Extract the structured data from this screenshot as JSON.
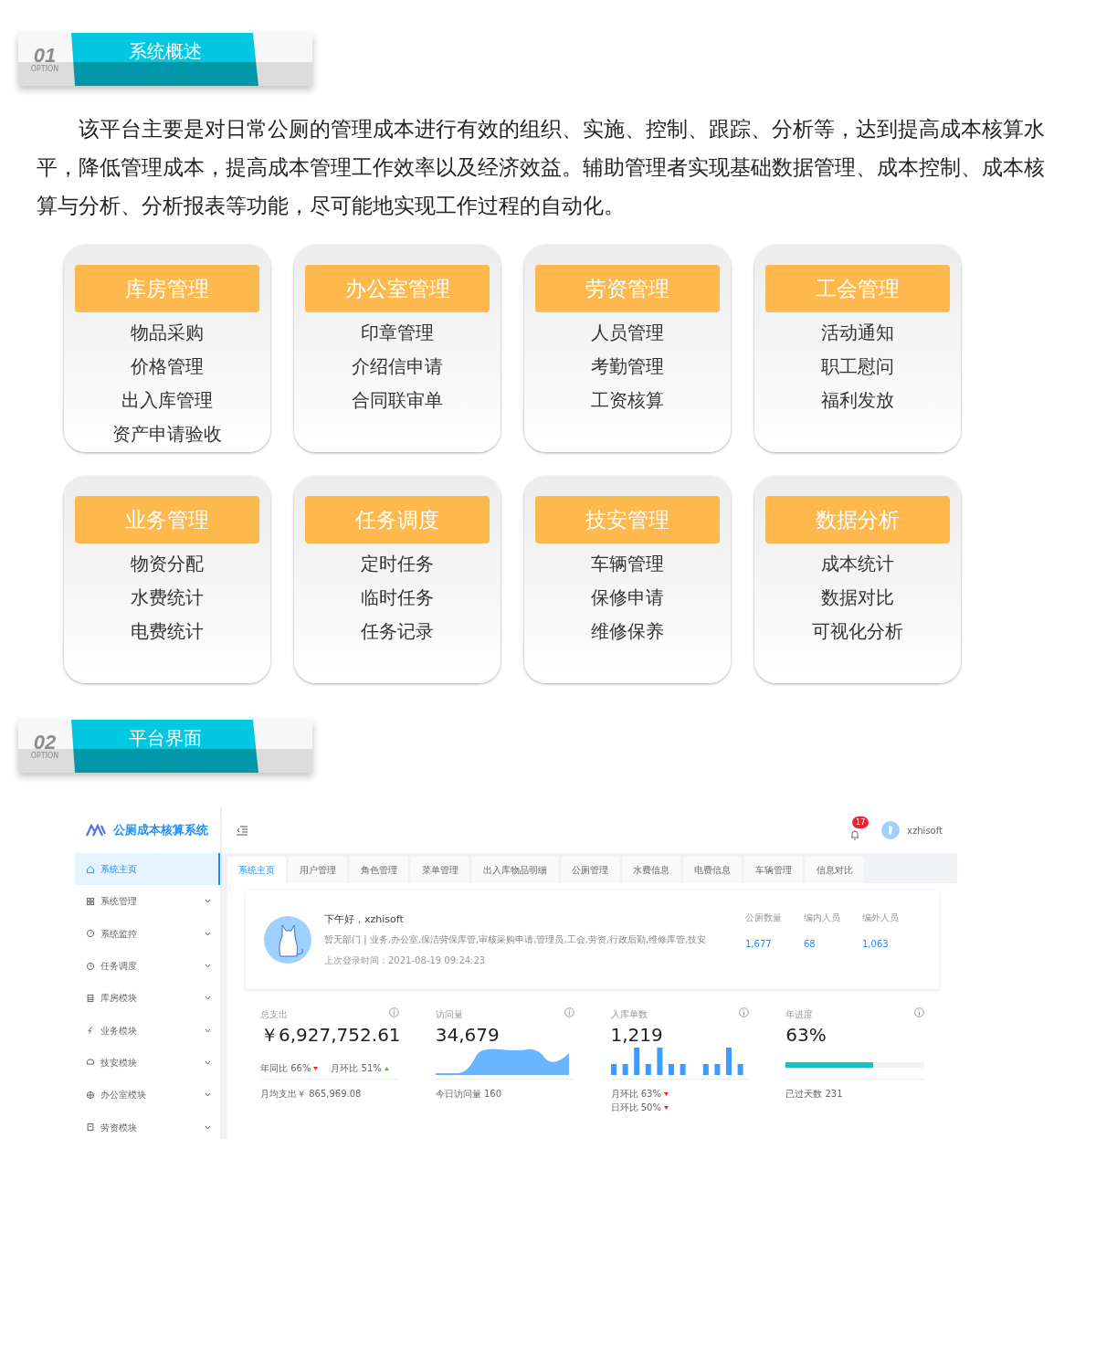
{
  "section_1": {
    "number": "01",
    "option": "OPTION",
    "title": "系统概述"
  },
  "intro": "该平台主要是对日常公厕的管理成本进行有效的组织、实施、控制、跟踪、分析等，达到提高成本核算水平，降低管理成本，提高成本管理工作效率以及经济效益。辅助管理者实现基础数据管理、成本控制、成本核算与分析、分析报表等功能，尽可能地实现工作过程的自动化。",
  "modules": [
    {
      "title": "库房管理",
      "items": [
        "物品采购",
        "价格管理",
        "出入库管理",
        "资产申请验收"
      ]
    },
    {
      "title": "办公室管理",
      "items": [
        "印章管理",
        "介绍信申请",
        "合同联审单"
      ]
    },
    {
      "title": "劳资管理",
      "items": [
        "人员管理",
        "考勤管理",
        "工资核算"
      ]
    },
    {
      "title": "工会管理",
      "items": [
        "活动通知",
        "职工慰问",
        "福利发放"
      ]
    },
    {
      "title": "业务管理",
      "items": [
        "物资分配",
        "水费统计",
        "电费统计"
      ]
    },
    {
      "title": "任务调度",
      "items": [
        "定时任务",
        "临时任务",
        "任务记录"
      ]
    },
    {
      "title": "技安管理",
      "items": [
        "车辆管理",
        "保修申请",
        "维修保养"
      ]
    },
    {
      "title": "数据分析",
      "items": [
        "成本统计",
        "数据对比",
        "可视化分析"
      ]
    }
  ],
  "section_2": {
    "number": "02",
    "option": "OPTION",
    "title": "平台界面"
  },
  "app": {
    "brand": "公厕成本核算系统",
    "sidebar": [
      {
        "label": "系统主页",
        "selected": true,
        "expandable": false
      },
      {
        "label": "系统管理",
        "selected": false,
        "expandable": true
      },
      {
        "label": "系统监控",
        "selected": false,
        "expandable": true
      },
      {
        "label": "任务调度",
        "selected": false,
        "expandable": true
      },
      {
        "label": "库房模块",
        "selected": false,
        "expandable": true
      },
      {
        "label": "业务模块",
        "selected": false,
        "expandable": true
      },
      {
        "label": "技安模块",
        "selected": false,
        "expandable": true
      },
      {
        "label": "办公室模块",
        "selected": false,
        "expandable": true
      },
      {
        "label": "劳资模块",
        "selected": false,
        "expandable": true
      }
    ],
    "notifications": "17",
    "user": "xzhisoft",
    "tabs": [
      {
        "label": "系统主页",
        "selected": true
      },
      {
        "label": "用户管理",
        "selected": false
      },
      {
        "label": "角色管理",
        "selected": false
      },
      {
        "label": "菜单管理",
        "selected": false
      },
      {
        "label": "出入库物品明细",
        "selected": false
      },
      {
        "label": "公厕管理",
        "selected": false
      },
      {
        "label": "水费信息",
        "selected": false
      },
      {
        "label": "电费信息",
        "selected": false
      },
      {
        "label": "车辆管理",
        "selected": false
      },
      {
        "label": "信息对比",
        "selected": false
      }
    ],
    "welcome": {
      "greeting": "下午好，xzhisoft",
      "roles": "暂无部门 | 业务,办公室,保洁劳保库管,审核采购申请,管理员,工会,劳资,行政后勤,维修库管,技安",
      "last_login": "上次登录时间：2021-08-19 09:24:23",
      "stats": [
        {
          "label": "公厕数量",
          "value": "1,677"
        },
        {
          "label": "编内人员",
          "value": "68"
        },
        {
          "label": "编外人员",
          "value": "1,063"
        }
      ]
    },
    "cards": [
      {
        "kind": "trend",
        "title": "总支出",
        "value": "￥6,927,752.61",
        "trends": [
          {
            "label": "年同比 66%",
            "up": false
          },
          {
            "label": "月环比 51%",
            "up": true
          }
        ],
        "footer": "月均支出￥ 865,969.08"
      },
      {
        "kind": "area",
        "title": "访问量",
        "value": "34,679",
        "footer": "今日访问量 160"
      },
      {
        "kind": "bars",
        "title": "入库单数",
        "value": "1,219",
        "trends": [
          {
            "label": "月环比 63%",
            "up": false
          },
          {
            "label": "日环比 50%",
            "up": false
          }
        ]
      },
      {
        "kind": "progress",
        "title": "年进度",
        "value": "63%",
        "level": 0.63,
        "footer": "已过天数 231"
      }
    ]
  }
}
